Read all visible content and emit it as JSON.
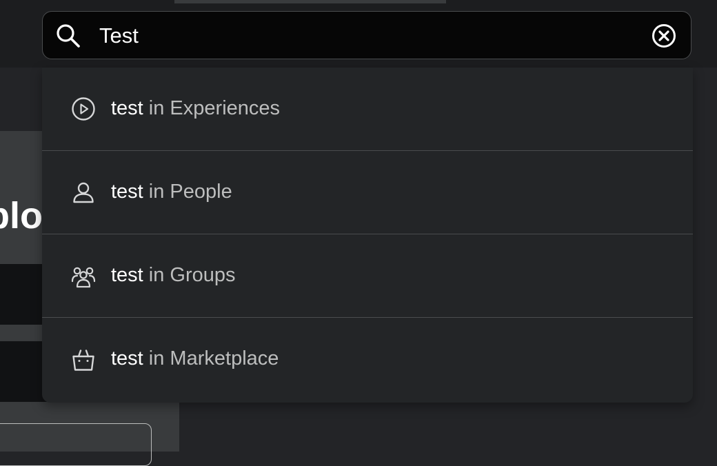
{
  "search": {
    "value": "Test",
    "placeholder": ""
  },
  "background": {
    "hero_text_fragment": "plo"
  },
  "suggestions": [
    {
      "query": "test",
      "context": " in Experiences",
      "icon": "play-circle-icon"
    },
    {
      "query": "test",
      "context": " in People",
      "icon": "person-icon"
    },
    {
      "query": "test",
      "context": " in Groups",
      "icon": "group-icon"
    },
    {
      "query": "test",
      "context": " in Marketplace",
      "icon": "shopping-bag-icon"
    }
  ],
  "colors": {
    "page_background": "#232427",
    "search_background": "#060606",
    "dropdown_background": "#232527",
    "divider": "#4a4c4e",
    "primary_text": "#ffffff",
    "secondary_text": "#bdbebe"
  }
}
